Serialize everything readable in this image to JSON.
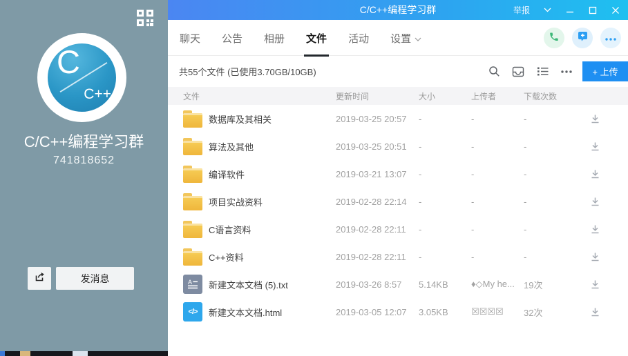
{
  "window": {
    "title": "C/C++编程学习群",
    "report_label": "举报"
  },
  "sidebar": {
    "group_name": "C/C++编程学习群",
    "group_number": "741818652",
    "send_message_label": "发消息",
    "logo_primary": "C",
    "logo_secondary": "C++"
  },
  "tabs": [
    {
      "label": "聊天",
      "active": false
    },
    {
      "label": "公告",
      "active": false
    },
    {
      "label": "相册",
      "active": false
    },
    {
      "label": "文件",
      "active": true
    },
    {
      "label": "活动",
      "active": false
    },
    {
      "label": "设置",
      "active": false,
      "dropdown": true
    }
  ],
  "toolbar": {
    "summary": "共55个文件 (已使用3.70GB/10GB)",
    "upload_label": "+ 上传"
  },
  "icons": {
    "html_glyph": "</>"
  },
  "files": {
    "columns": {
      "name": "文件",
      "time": "更新时间",
      "size": "大小",
      "uploader": "上传者",
      "downloads": "下载次数"
    },
    "rows": [
      {
        "icon": "folder-icon",
        "name": "数据库及其相关",
        "time": "2019-03-25 20:57",
        "size": "-",
        "uploader": "-",
        "downloads": "-"
      },
      {
        "icon": "folder-icon",
        "name": "算法及其他",
        "time": "2019-03-25 20:51",
        "size": "-",
        "uploader": "-",
        "downloads": "-"
      },
      {
        "icon": "folder-icon",
        "name": "编译软件",
        "time": "2019-03-21 13:07",
        "size": "-",
        "uploader": "-",
        "downloads": "-"
      },
      {
        "icon": "folder-icon",
        "name": "项目实战资料",
        "time": "2019-02-28 22:14",
        "size": "-",
        "uploader": "-",
        "downloads": "-"
      },
      {
        "icon": "folder-icon",
        "name": "C语言资料",
        "time": "2019-02-28 22:11",
        "size": "-",
        "uploader": "-",
        "downloads": "-"
      },
      {
        "icon": "folder-icon",
        "name": "C++资料",
        "time": "2019-02-28 22:11",
        "size": "-",
        "uploader": "-",
        "downloads": "-"
      },
      {
        "icon": "text-file-icon",
        "name": "新建文本文档 (5).txt",
        "time": "2019-03-26 8:57",
        "size": "5.14KB",
        "uploader": "♦◇My he...",
        "downloads": "19次"
      },
      {
        "icon": "html-file-icon",
        "name": "新建文本文档.html",
        "time": "2019-03-05 12:07",
        "size": "3.05KB",
        "uploader": "☒☒☒☒",
        "downloads": "32次"
      }
    ]
  },
  "colors": {
    "titlebar_start": "#4b86f2",
    "titlebar_end": "#1fc0f0",
    "sidebar_bg": "#7f9aa6",
    "accent_blue": "#1e8ff2",
    "folder_yellow": "#f3bd3f",
    "text_icon_gray": "#7e8ba1",
    "html_icon_blue": "#2ea7ec",
    "phone_green": "#3cb878"
  }
}
